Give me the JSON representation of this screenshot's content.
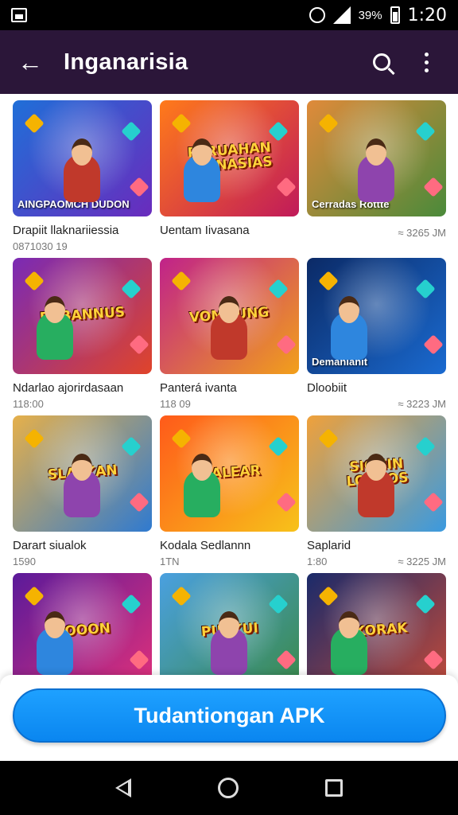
{
  "status_bar": {
    "battery_percent": "39%",
    "time": "1:20",
    "icons": [
      "gallery-icon",
      "alarm-icon",
      "signal-icon",
      "battery-icon"
    ]
  },
  "app_bar": {
    "title": "Inganarisia",
    "back_icon": "back-arrow-icon",
    "search_icon": "search-icon",
    "menu_icon": "more-vert-icon"
  },
  "cards": [
    {
      "name": "Drapiit llaknariiessia",
      "meta_left": "0871030 19",
      "meta_right": "",
      "logo": "",
      "banner": "AINGPAOMCH DUDON",
      "bg": [
        "#1f6fd8",
        "#6a2bbd"
      ]
    },
    {
      "name": "Uentam Iivasana",
      "meta_left": "",
      "meta_right": "",
      "logo": "PARUAHAN MIENASIAS",
      "banner": "",
      "bg": [
        "#ff7a1a",
        "#c01a5a"
      ]
    },
    {
      "name": "",
      "meta_left": "",
      "meta_right": "≈ 3265 JM",
      "logo": "",
      "banner": "Cerradas Rottte",
      "bg": [
        "#e08a3a",
        "#4a8a3a"
      ]
    },
    {
      "name": "Ndarlao ajorirdasaan",
      "meta_left": "118:00",
      "meta_right": "",
      "logo": "PDBANNUS",
      "banner": "",
      "bg": [
        "#7a2ab5",
        "#e0442a"
      ]
    },
    {
      "name": "Panterá ivanta",
      "meta_left": "118 09",
      "meta_right": "",
      "logo": "VOMNUNG",
      "banner": "",
      "bg": [
        "#c0228a",
        "#f2a01a"
      ]
    },
    {
      "name": "Dloobiit",
      "meta_left": "",
      "meta_right": "≈ 3223 JM",
      "logo": "",
      "banner": "Demanianit",
      "bg": [
        "#0b2a66",
        "#1a6ad0"
      ]
    },
    {
      "name": "Darart siualok",
      "meta_left": "1590",
      "meta_right": "",
      "logo": "SLALKAN",
      "banner": "",
      "bg": [
        "#e6b04a",
        "#2f7ad0"
      ]
    },
    {
      "name": "Kodala Sedlannn",
      "meta_left": "1TN",
      "meta_right": "",
      "logo": "MALEAR",
      "banner": "",
      "bg": [
        "#ff5a1a",
        "#f7c21a"
      ]
    },
    {
      "name": "Saplarid",
      "meta_left": "1:80",
      "meta_right": "≈ 3225 JM",
      "logo": "SIONIN LOAGOS",
      "banner": "",
      "bg": [
        "#f0a13a",
        "#3a9ae0"
      ]
    },
    {
      "name": "",
      "meta_left": "",
      "meta_right": "",
      "logo": "KOOON",
      "banner": "",
      "bg": [
        "#5a1a9a",
        "#e0307a"
      ]
    },
    {
      "name": "",
      "meta_left": "",
      "meta_right": "",
      "logo": "PUAKUI",
      "banner": "",
      "bg": [
        "#4aa0e0",
        "#3a8a4a"
      ]
    },
    {
      "name": "",
      "meta_left": "",
      "meta_right": "",
      "logo": "SKORAK",
      "banner": "",
      "bg": [
        "#1a2a6a",
        "#c04a3a"
      ]
    }
  ],
  "download_button": {
    "label": "Tudantiongan APK",
    "color": "#1ea1ff"
  },
  "nav_bar": {
    "icons": [
      "nav-back-icon",
      "nav-home-icon",
      "nav-recents-icon"
    ]
  }
}
